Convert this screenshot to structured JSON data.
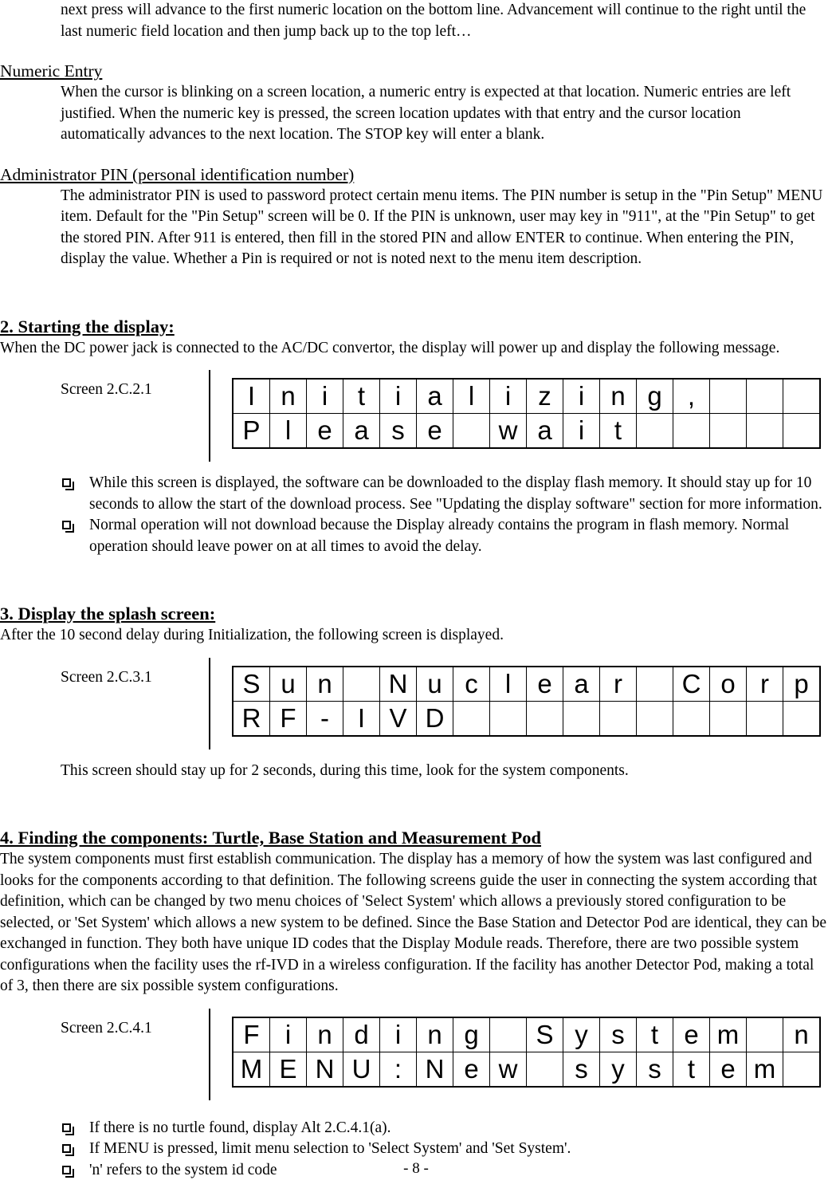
{
  "page": {
    "footer": "- 8 -",
    "lcd_columns": 16
  },
  "intro": {
    "continued_paragraph": "next press will advance to the first numeric location on the bottom line. Advancement will continue to the right until the last numeric field location and then jump back up to the top left…"
  },
  "numeric_entry": {
    "heading": "Numeric Entry",
    "paragraph": "When the cursor is blinking on a screen location, a numeric entry is expected at that location. Numeric entries are left justified. When the numeric key is pressed, the screen location updates with that entry and the cursor location automatically advances to the next location. The STOP key will enter a blank."
  },
  "admin_pin": {
    "heading": "Administrator PIN (personal identification number)",
    "paragraph": "The administrator PIN is used to password protect certain menu items. The PIN number is setup in the \"Pin Setup\" MENU item. Default for the \"Pin Setup\" screen will be 0. If the PIN is unknown, user may key in \"911\", at the \"Pin Setup\" to get the stored PIN. After 911 is entered, then fill in the stored PIN and allow ENTER to continue. When entering the PIN, display the value. Whether a Pin is required or not is noted next to the menu item description."
  },
  "section2": {
    "heading": "2. Starting the display:",
    "paragraph": "When the DC power jack is connected to the AC/DC convertor, the display will power up and display the following message.",
    "screen": {
      "label": "Screen 2.C.2.1",
      "line1": [
        "I",
        "n",
        "i",
        "t",
        "i",
        "a",
        "l",
        "i",
        "z",
        "i",
        "n",
        "g",
        ",",
        "",
        "",
        ""
      ],
      "line2": [
        "P",
        "l",
        "e",
        "a",
        "s",
        "e",
        "",
        "w",
        "a",
        "i",
        "t",
        "",
        "",
        "",
        "",
        ""
      ],
      "line1_text": "Initializing,",
      "line2_text": "Please wait"
    },
    "bullets": [
      "While this screen is displayed, the software can be downloaded to the display flash memory. It should stay up for 10 seconds to allow the start of the download process. See \"Updating the display software\" section for more information.",
      "Normal operation will not download because the Display already contains the program in flash memory. Normal operation should leave power on at all times to avoid the delay."
    ]
  },
  "section3": {
    "heading": "3. Display the splash screen:",
    "paragraph": "After the 10 second delay during Initialization, the following screen is displayed.",
    "screen": {
      "label": "Screen 2.C.3.1",
      "line1": [
        "S",
        "u",
        "n",
        "",
        "N",
        "u",
        "c",
        "l",
        "e",
        "a",
        "r",
        "",
        "C",
        "o",
        "r",
        "p"
      ],
      "line2": [
        "R",
        "F",
        "-",
        "I",
        "V",
        "D",
        "",
        "",
        "",
        "",
        "",
        "",
        "",
        "",
        "",
        ""
      ],
      "line1_text": "Sun Nuclear Corp",
      "line2_text": "RF-IVD"
    },
    "note": "This screen should stay up for 2 seconds, during this time, look for the system components."
  },
  "section4": {
    "heading": "4. Finding the components: Turtle, Base Station and Measurement Pod",
    "paragraph": "The system components must first establish communication. The display has a memory of how the system was last configured and looks for the components according to that definition. The following screens guide the user in connecting the system according that definition, which can be changed by two menu choices of 'Select System' which allows a previously stored configuration to be selected, or 'Set System' which allows a new system to be defined. Since the Base Station and Detector Pod are identical, they can be exchanged in function. They both have unique ID codes that the Display Module reads. Therefore, there are two possible system configurations when the facility uses the  rf-IVD in a wireless configuration. If the facility has another Detector Pod, making a total of 3, then there are six possible system configurations.",
    "screen": {
      "label": "Screen 2.C.4.1",
      "line1": [
        "F",
        "i",
        "n",
        "d",
        "i",
        "n",
        "g",
        "",
        "S",
        "y",
        "s",
        "t",
        "e",
        "m",
        "",
        "n"
      ],
      "line2": [
        "M",
        "E",
        "N",
        "U",
        ":",
        "N",
        "e",
        "w",
        "",
        "s",
        "y",
        "s",
        "t",
        "e",
        "m",
        ""
      ],
      "line1_text": "Finding System n",
      "line2_text": "MENU:New system"
    },
    "bullets": [
      "If  there is no turtle found, display Alt 2.C.4.1(a).",
      "If MENU is pressed, limit menu selection to 'Select System' and 'Set System'.",
      "'n' refers to the system id code"
    ]
  }
}
